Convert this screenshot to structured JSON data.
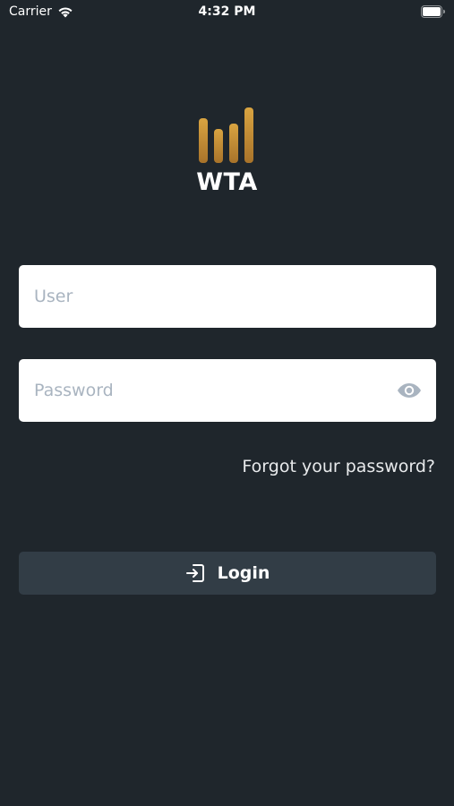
{
  "status_bar": {
    "carrier": "Carrier",
    "time": "4:32 PM",
    "wifi_icon": "wifi-icon",
    "battery_icon": "battery-full-icon"
  },
  "logo": {
    "text": "WTA",
    "icon": "bar-signal-icon",
    "color": "#c8922e"
  },
  "form": {
    "user_placeholder": "User",
    "user_value": "",
    "password_placeholder": "Password",
    "password_value": "",
    "password_toggle_icon": "eye-icon",
    "forgot_label": "Forgot your password?",
    "login_label": "Login",
    "login_icon": "login-icon"
  },
  "colors": {
    "background": "#1f262c",
    "button": "#323d46",
    "placeholder": "#a9b4c0",
    "accent": "#c8922e"
  }
}
